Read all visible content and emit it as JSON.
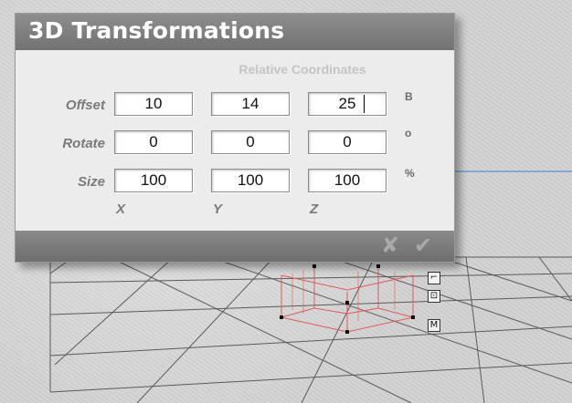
{
  "dialog": {
    "title": "3D Transformations",
    "subheader": "Relative Coordinates",
    "rows": [
      {
        "label": "Offset",
        "unit": "B",
        "values": [
          "10",
          "14",
          "25"
        ]
      },
      {
        "label": "Rotate",
        "unit": "o",
        "values": [
          "0",
          "0",
          "0"
        ]
      },
      {
        "label": "Size",
        "unit": "%",
        "values": [
          "100",
          "100",
          "100"
        ]
      }
    ],
    "axes": [
      "X",
      "Y",
      "Z"
    ],
    "cancel_glyph": "✘",
    "ok_glyph": "✔"
  },
  "viewport": {
    "handle_m_label": "M"
  }
}
